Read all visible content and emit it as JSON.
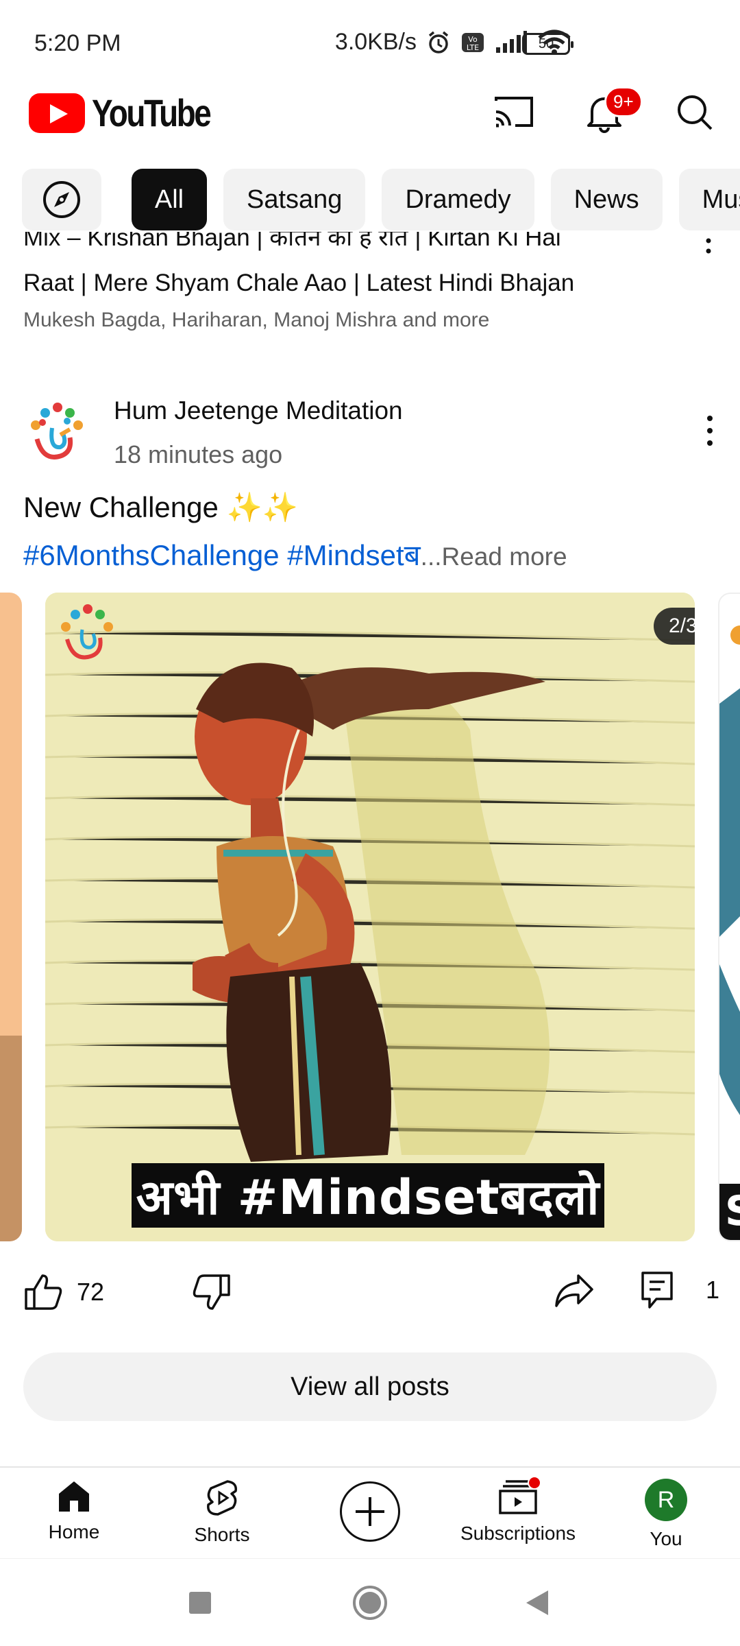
{
  "status_bar": {
    "time": "5:20 PM",
    "network_speed": "3.0KB/s",
    "battery": "50",
    "icons": [
      "alarm-icon",
      "volte-icon",
      "signal-icon",
      "wifi-icon",
      "battery-icon"
    ]
  },
  "header": {
    "logo_text": "YouTube",
    "notification_badge": "9+",
    "buttons": [
      "cast-icon",
      "bell-icon",
      "search-icon"
    ]
  },
  "chips": {
    "explore_icon": "compass-icon",
    "items": [
      "All",
      "Satsang",
      "Dramedy",
      "News",
      "Mus"
    ],
    "selected": "All"
  },
  "prev_video": {
    "title_line1": "Mix – Krishan Bhajan | कीर्तन की है रात | Kirtan Ki Hai",
    "title_line2": "Raat | Mere Shyam Chale Aao | Latest Hindi Bhajan",
    "subtitle": "Mukesh Bagda, Hariharan, Manoj Mishra and more"
  },
  "post": {
    "channel": "Hum Jeetenge Meditation",
    "time": "18 minutes ago",
    "text": "New Challenge ✨✨",
    "tags": "#6MonthsChallenge #Mindsetब",
    "ellipsis": "...",
    "read_more": "Read more",
    "slide_counter": "2/3",
    "image_caption": "अभी #Mindsetबदलो",
    "likes": "72",
    "comments": "1",
    "view_all": "View all posts"
  },
  "bottom_nav": {
    "home": "Home",
    "shorts": "Shorts",
    "subscriptions": "Subscriptions",
    "you": "You",
    "you_initial": "R"
  },
  "colors": {
    "brand_red": "#ff0000",
    "link_blue": "#065fd4",
    "chip_bg": "#f2f2f2",
    "avatar_green": "#1e7a2a"
  }
}
